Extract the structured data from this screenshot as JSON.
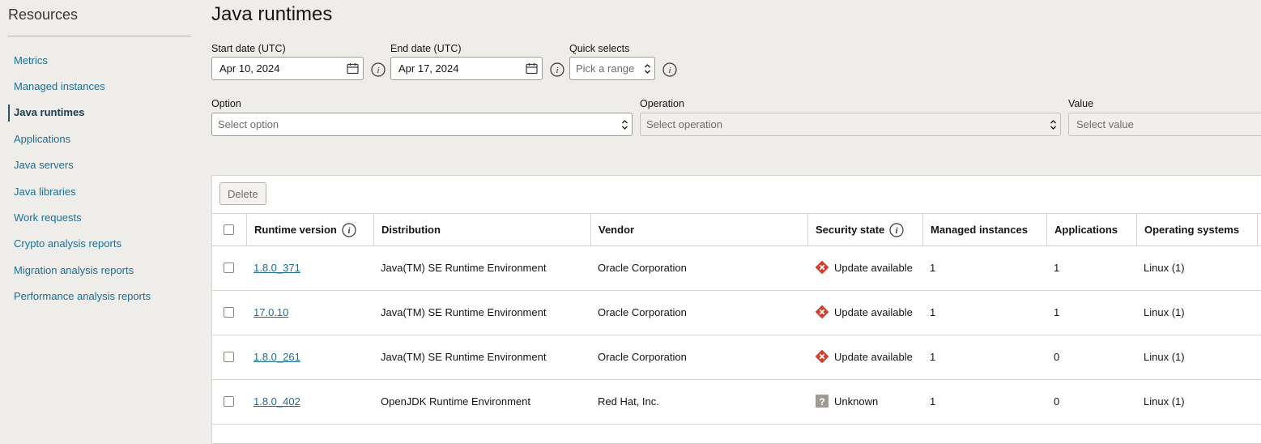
{
  "sidebar": {
    "title": "Resources",
    "items": [
      {
        "label": "Metrics",
        "active": false
      },
      {
        "label": "Managed instances",
        "active": false
      },
      {
        "label": "Java runtimes",
        "active": true
      },
      {
        "label": "Applications",
        "active": false
      },
      {
        "label": "Java servers",
        "active": false
      },
      {
        "label": "Java libraries",
        "active": false
      },
      {
        "label": "Work requests",
        "active": false
      },
      {
        "label": "Crypto analysis reports",
        "active": false
      },
      {
        "label": "Migration analysis reports",
        "active": false
      },
      {
        "label": "Performance analysis reports",
        "active": false
      }
    ]
  },
  "page": {
    "title": "Java runtimes"
  },
  "filters": {
    "start_date": {
      "label": "Start date (UTC)",
      "value": "Apr 10, 2024"
    },
    "end_date": {
      "label": "End date (UTC)",
      "value": "Apr 17, 2024"
    },
    "quick_selects": {
      "label": "Quick selects",
      "placeholder": "Pick a range"
    },
    "option": {
      "label": "Option",
      "placeholder": "Select option"
    },
    "operation": {
      "label": "Operation",
      "placeholder": "Select operation"
    },
    "value": {
      "label": "Value",
      "placeholder": "Select value"
    }
  },
  "toolbar": {
    "delete_label": "Delete"
  },
  "table": {
    "columns": [
      "Runtime version",
      "Distribution",
      "Vendor",
      "Security state",
      "Managed instances",
      "Applications",
      "Operating systems"
    ],
    "rows": [
      {
        "version": "1.8.0_371",
        "distribution": "Java(TM) SE Runtime Environment",
        "vendor": "Oracle Corporation",
        "security": "Update available",
        "security_icon": "error-icon",
        "managed": "1",
        "applications": "1",
        "os": "Linux (1)"
      },
      {
        "version": "17.0.10",
        "distribution": "Java(TM) SE Runtime Environment",
        "vendor": "Oracle Corporation",
        "security": "Update available",
        "security_icon": "error-icon",
        "managed": "1",
        "applications": "1",
        "os": "Linux (1)"
      },
      {
        "version": "1.8.0_261",
        "distribution": "Java(TM) SE Runtime Environment",
        "vendor": "Oracle Corporation",
        "security": "Update available",
        "security_icon": "error-icon",
        "managed": "1",
        "applications": "0",
        "os": "Linux (1)"
      },
      {
        "version": "1.8.0_402",
        "distribution": "OpenJDK Runtime Environment",
        "vendor": "Red Hat, Inc.",
        "security": "Unknown",
        "security_icon": "unknown-icon",
        "managed": "1",
        "applications": "0",
        "os": "Linux (1)"
      }
    ]
  },
  "colors": {
    "link": "#1c6e94",
    "error": "#d33e2f",
    "unknown": "#9e9a94"
  }
}
